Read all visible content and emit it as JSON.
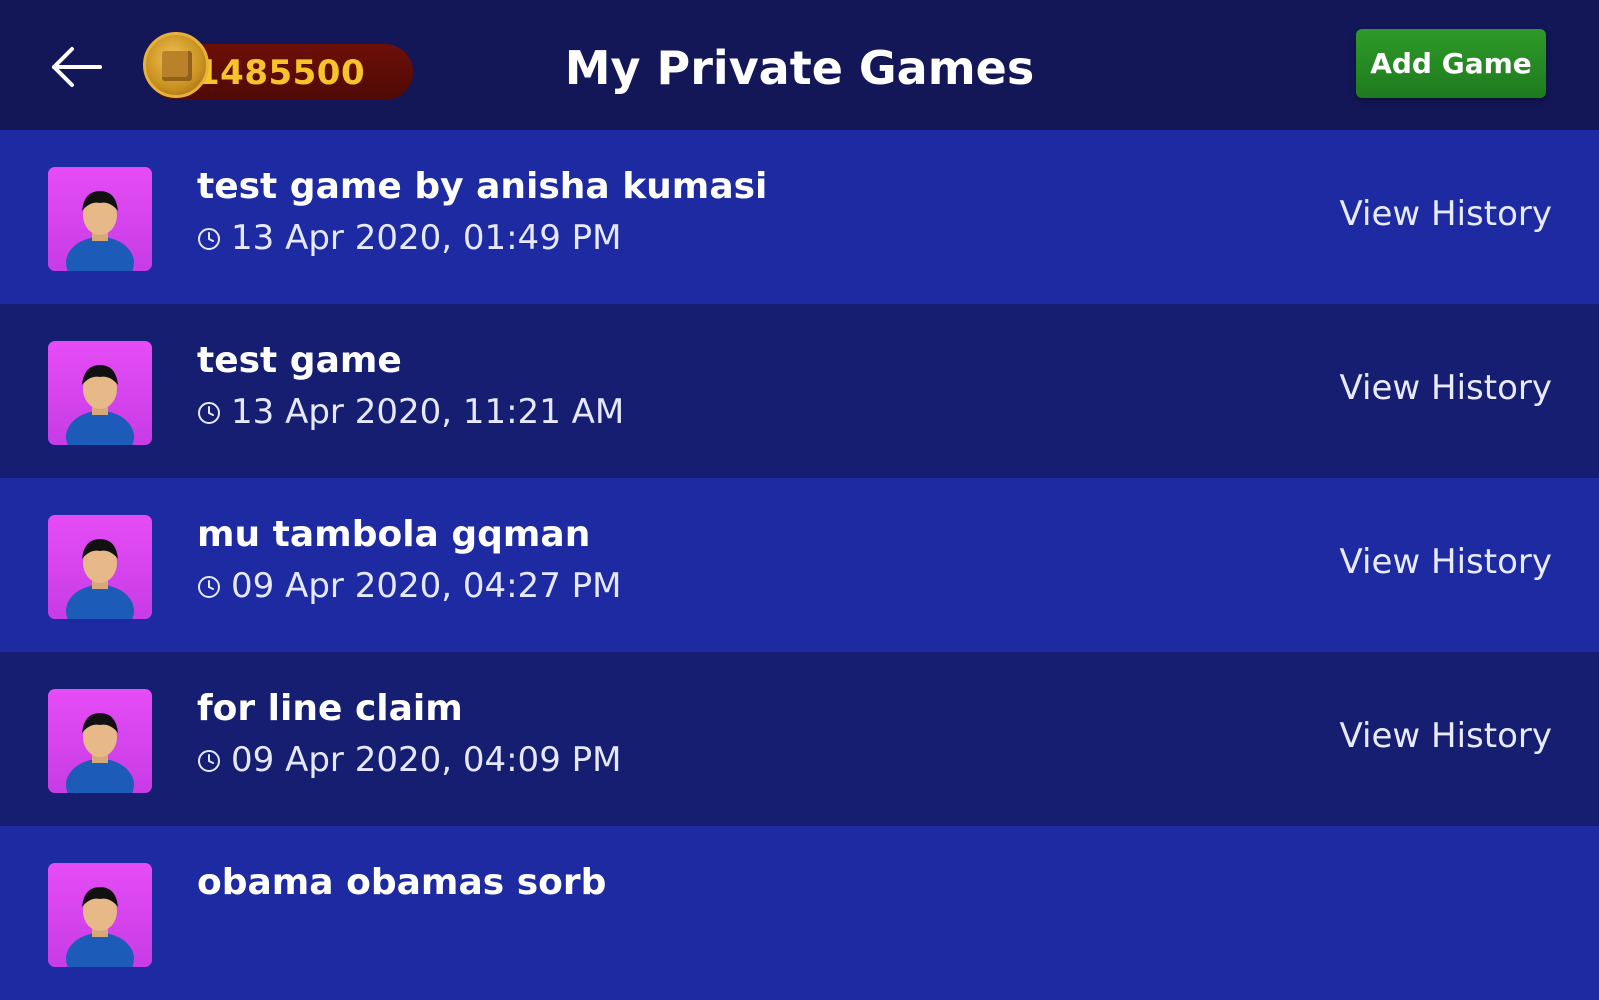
{
  "header": {
    "title": "My Private Games",
    "coin_balance": "1485500",
    "add_button_label": "Add Game"
  },
  "games": [
    {
      "name": "test game by anisha kumasi",
      "datetime": "13 Apr 2020, 01:49 PM",
      "action_label": "View History"
    },
    {
      "name": "test game",
      "datetime": "13 Apr 2020, 11:21 AM",
      "action_label": "View History"
    },
    {
      "name": "mu tambola gqman",
      "datetime": "09 Apr 2020, 04:27 PM",
      "action_label": "View History"
    },
    {
      "name": "for line claim",
      "datetime": "09 Apr 2020, 04:09 PM",
      "action_label": "View History"
    },
    {
      "name": "obama obamas sorb",
      "datetime": "",
      "action_label": ""
    }
  ],
  "icons": {
    "back": "back-arrow-icon",
    "coin": "coin-icon",
    "avatar": "user-avatar-icon",
    "clock": "clock-icon"
  },
  "colors": {
    "header_bg": "#131758",
    "row_light": "#1d2aa2",
    "row_dark": "#161e72",
    "coin_text": "#f6c42a",
    "add_button": "#2e9a2a",
    "avatar_bg": "#e64cf5"
  }
}
